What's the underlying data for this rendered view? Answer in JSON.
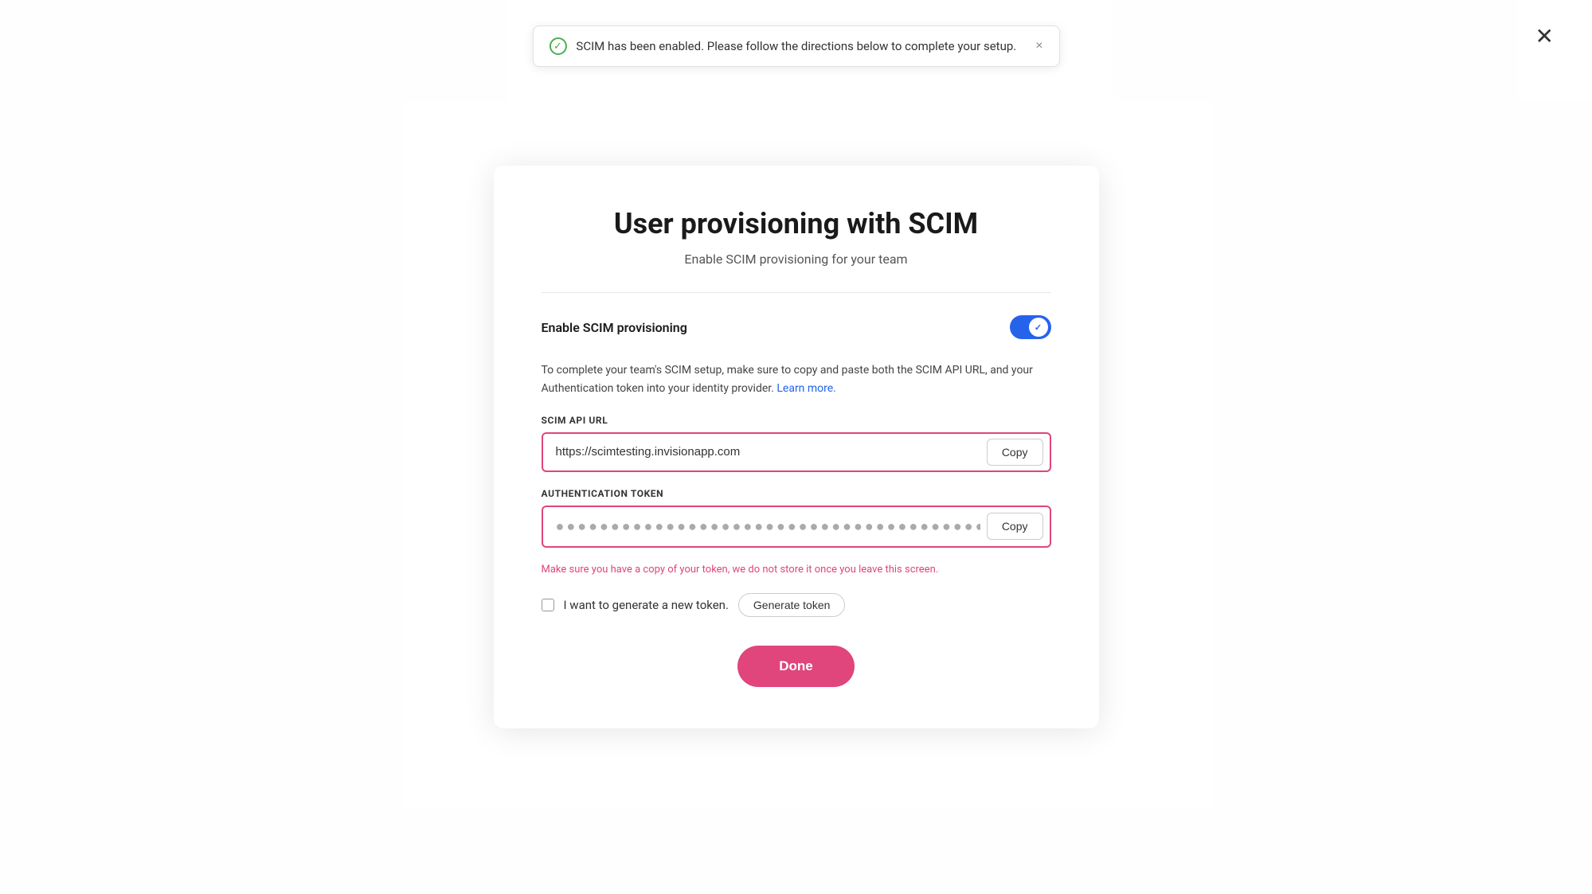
{
  "modal": {
    "title": "User provisioning with SCIM",
    "subtitle": "Enable SCIM provisioning for your team",
    "close_label": "✕"
  },
  "toast": {
    "message": "SCIM has been enabled. Please follow the directions below to complete your setup.",
    "close_label": "×",
    "icon_check": "✓"
  },
  "toggle": {
    "label": "Enable SCIM provisioning",
    "enabled": true
  },
  "description": {
    "text_before_link": "To complete your team's SCIM setup, make sure to copy and paste both the SCIM API URL, and your Authentication token into your identity provider. ",
    "link_text": "Learn more.",
    "text_after_link": ""
  },
  "scim_url": {
    "label": "SCIM API URL",
    "value": "https://scimtesting.invisionapp.com",
    "copy_label": "Copy"
  },
  "auth_token": {
    "label": "Authentication token",
    "value": "●●●●●●●●●●●●●●●●●●●●●●●●●●●●●●●●●●●●●●●●●●●●●●●●●●●●●●●●●",
    "copy_label": "Copy",
    "warning": "Make sure you have a copy of your token, we do not store it once you leave this screen."
  },
  "new_token": {
    "label": "I want to generate a new token.",
    "generate_label": "Generate token"
  },
  "done_button": {
    "label": "Done"
  }
}
